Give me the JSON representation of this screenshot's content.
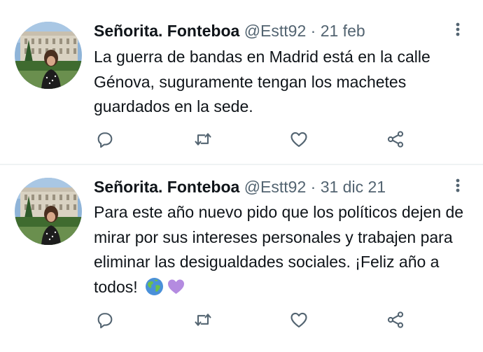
{
  "colors": {
    "text": "#0f1419",
    "secondary": "#536471",
    "divider": "#eff3f4"
  },
  "tweets": [
    {
      "display_name": "Señorita. Fonteboa",
      "handle": "@Estt92",
      "separator": "·",
      "date": "21 feb",
      "text": "La guerra de bandas en Madrid está en la calle Génova, suguramente tengan los machetes guardados en la sede.",
      "emojis": [],
      "actions": [
        "reply-icon",
        "retweet-icon",
        "like-icon",
        "share-icon"
      ]
    },
    {
      "display_name": "Señorita. Fonteboa",
      "handle": "@Estt92",
      "separator": "·",
      "date": "31 dic 21",
      "text": "Para este año nuevo pido que los políticos dejen de mirar por sus intereses personales y trabajen para eliminar las desigualdades sociales. ¡Feliz año a todos!",
      "emojis": [
        "globe-icon",
        "purple-heart-icon"
      ],
      "actions": [
        "reply-icon",
        "retweet-icon",
        "like-icon",
        "share-icon"
      ]
    }
  ]
}
